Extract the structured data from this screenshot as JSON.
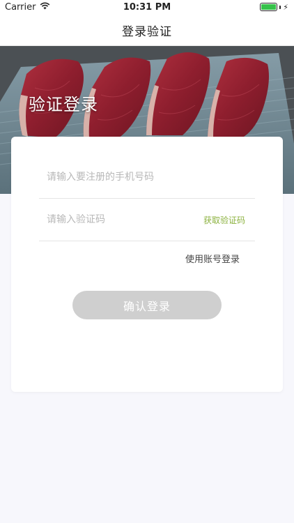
{
  "status_bar": {
    "carrier": "Carrier",
    "time": "10:31 PM",
    "battery_level": 1.0,
    "battery_color": "#36c24a"
  },
  "nav": {
    "title": "登录验证"
  },
  "hero": {
    "title": "验证登录"
  },
  "form": {
    "phone_placeholder": "请输入要注册的手机号码",
    "code_placeholder": "请输入验证码",
    "get_code_label": "获取验证码",
    "account_login_label": "使用账号登录",
    "confirm_label": "确认登录"
  },
  "colors": {
    "accent_green": "#8cb23f",
    "button_disabled": "#cfcfcf",
    "page_background": "#f7f7fc"
  }
}
